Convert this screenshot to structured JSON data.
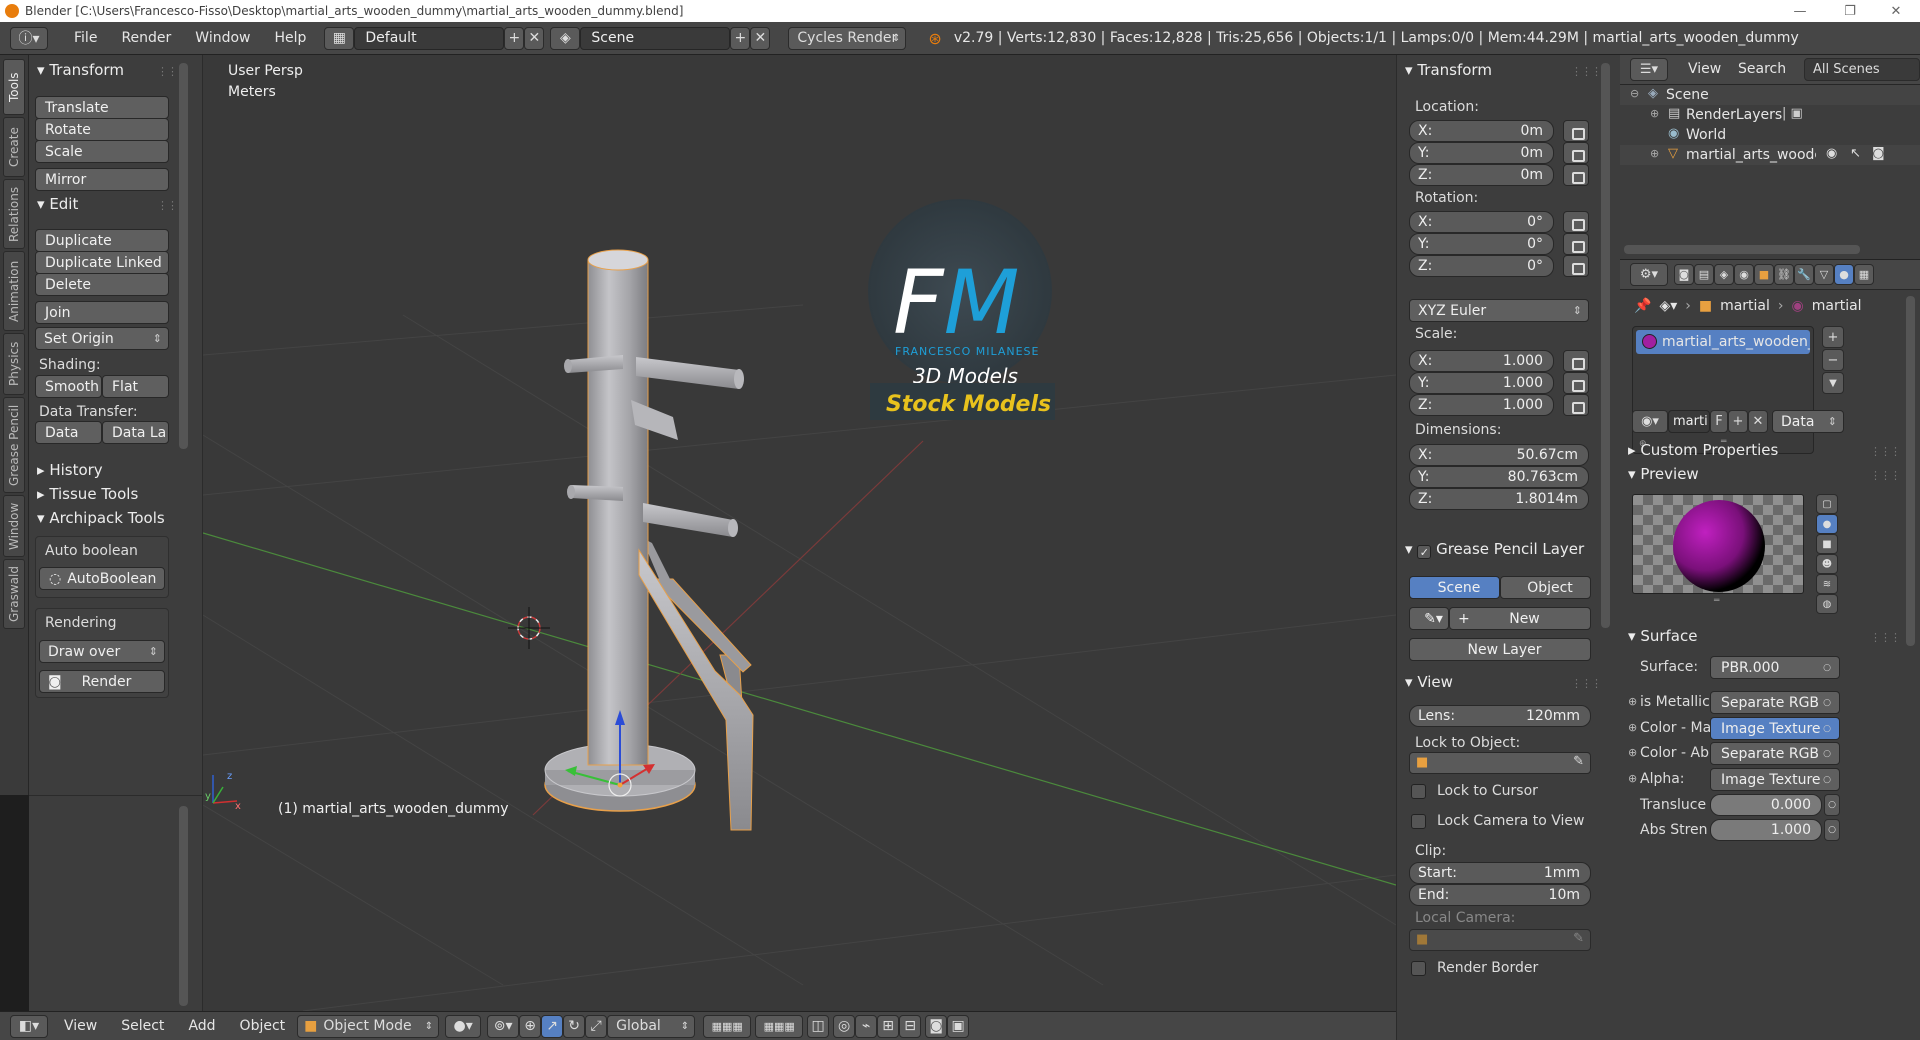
{
  "window": {
    "title": "Blender [C:\\Users\\Francesco-Fisso\\Desktop\\martial_arts_wooden_dummy\\martial_arts_wooden_dummy.blend]"
  },
  "menu": {
    "items": [
      "File",
      "Render",
      "Window",
      "Help"
    ],
    "layout": "Default",
    "scene": "Scene",
    "engine": "Cycles Render",
    "stats": "v2.79 | Verts:12,830 | Faces:12,828 | Tris:25,656 | Objects:1/1 | Lamps:0/0 | Mem:44.29M | martial_arts_wooden_dummy"
  },
  "left_tabs": [
    "Tools",
    "Create",
    "Relations",
    "Animation",
    "Physics",
    "Grease Pencil",
    "Window",
    "Graswald"
  ],
  "tools": {
    "transform_title": "Transform",
    "translate": "Translate",
    "rotate": "Rotate",
    "scale": "Scale",
    "mirror": "Mirror",
    "edit_title": "Edit",
    "duplicate": "Duplicate",
    "duplicate_linked": "Duplicate Linked",
    "delete": "Delete",
    "join": "Join",
    "set_origin": "Set Origin",
    "shading": "Shading:",
    "smooth": "Smooth",
    "flat": "Flat",
    "data_transfer": "Data Transfer:",
    "data": "Data",
    "data_la": "Data La",
    "history": "History",
    "tissue": "Tissue Tools",
    "archipack": "Archipack Tools",
    "auto_boolean": "Auto boolean",
    "autoboolean_btn": "AutoBoolean",
    "rendering": "Rendering",
    "draw_over": "Draw over",
    "render": "Render"
  },
  "viewport": {
    "view_name": "User Persp",
    "units": "Meters",
    "object_label": "(1) martial_arts_wooden_dummy",
    "logo_letters": "FM",
    "logo_name": "FRANCESCO MILANESE",
    "logo_sub": "3D Models",
    "logo_banner": "Stock Models"
  },
  "bottom": {
    "view": "View",
    "select": "Select",
    "add": "Add",
    "object": "Object",
    "mode": "Object Mode",
    "orientation": "Global"
  },
  "npanel": {
    "transform_title": "Transform",
    "location": "Location:",
    "rotation": "Rotation:",
    "scale": "Scale:",
    "dimensions": "Dimensions:",
    "loc": [
      {
        "axis": "X:",
        "value": "0m"
      },
      {
        "axis": "Y:",
        "value": "0m"
      },
      {
        "axis": "Z:",
        "value": "0m"
      }
    ],
    "rot": [
      {
        "axis": "X:",
        "value": "0°"
      },
      {
        "axis": "Y:",
        "value": "0°"
      },
      {
        "axis": "Z:",
        "value": "0°"
      }
    ],
    "rot_mode": "XYZ Euler",
    "scl": [
      {
        "axis": "X:",
        "value": "1.000"
      },
      {
        "axis": "Y:",
        "value": "1.000"
      },
      {
        "axis": "Z:",
        "value": "1.000"
      }
    ],
    "dim": [
      {
        "axis": "X:",
        "value": "50.67cm"
      },
      {
        "axis": "Y:",
        "value": "80.763cm"
      },
      {
        "axis": "Z:",
        "value": "1.8014m"
      }
    ],
    "gp_title": "Grease Pencil Layer",
    "gp_scene": "Scene",
    "gp_object": "Object",
    "gp_new": "New",
    "gp_new_layer": "New Layer",
    "view_title": "View",
    "lens_label": "Lens:",
    "lens": "120mm",
    "lock_obj": "Lock to Object:",
    "lock_cursor": "Lock to Cursor",
    "lock_camera": "Lock Camera to View",
    "clip": "Clip:",
    "start_label": "Start:",
    "start": "1mm",
    "end_label": "End:",
    "end": "10m",
    "local_camera": "Local Camera:",
    "render_border": "Render Border"
  },
  "outliner": {
    "view": "View",
    "search": "Search",
    "filter": "All Scenes",
    "items": [
      {
        "label": "Scene"
      },
      {
        "label": "RenderLayers"
      },
      {
        "label": "World"
      },
      {
        "label": "martial_arts_wooden_d"
      }
    ]
  },
  "properties": {
    "breadcrumb_obj": "martial",
    "breadcrumb_mat": "martial",
    "material_slot": "martial_arts_wooden_du...",
    "mat_name": "marti",
    "mat_f": "F",
    "mat_link": "Data",
    "custom_props": "Custom Properties",
    "preview": "Preview",
    "surface_title": "Surface",
    "surface_label": "Surface:",
    "surface_value": "PBR.000",
    "inputs": [
      {
        "label": "is Metallic",
        "value": "Separate RGB"
      },
      {
        "label": "Color - Ma",
        "value": "Image Texture"
      },
      {
        "label": "Color - Ab",
        "value": "Separate RGB"
      },
      {
        "label": "Alpha:",
        "value": "Image Texture"
      }
    ],
    "translucence_label": "Transluce",
    "translucence": "0.000",
    "abs_label": "Abs Stren",
    "abs": "1.000"
  },
  "colors": {
    "accent": "#5680c2",
    "viewport_bg": "#393939",
    "logo_blue": "#1e9fd8",
    "logo_yellow": "#e8c21d",
    "material_purple": "#a020a0"
  }
}
